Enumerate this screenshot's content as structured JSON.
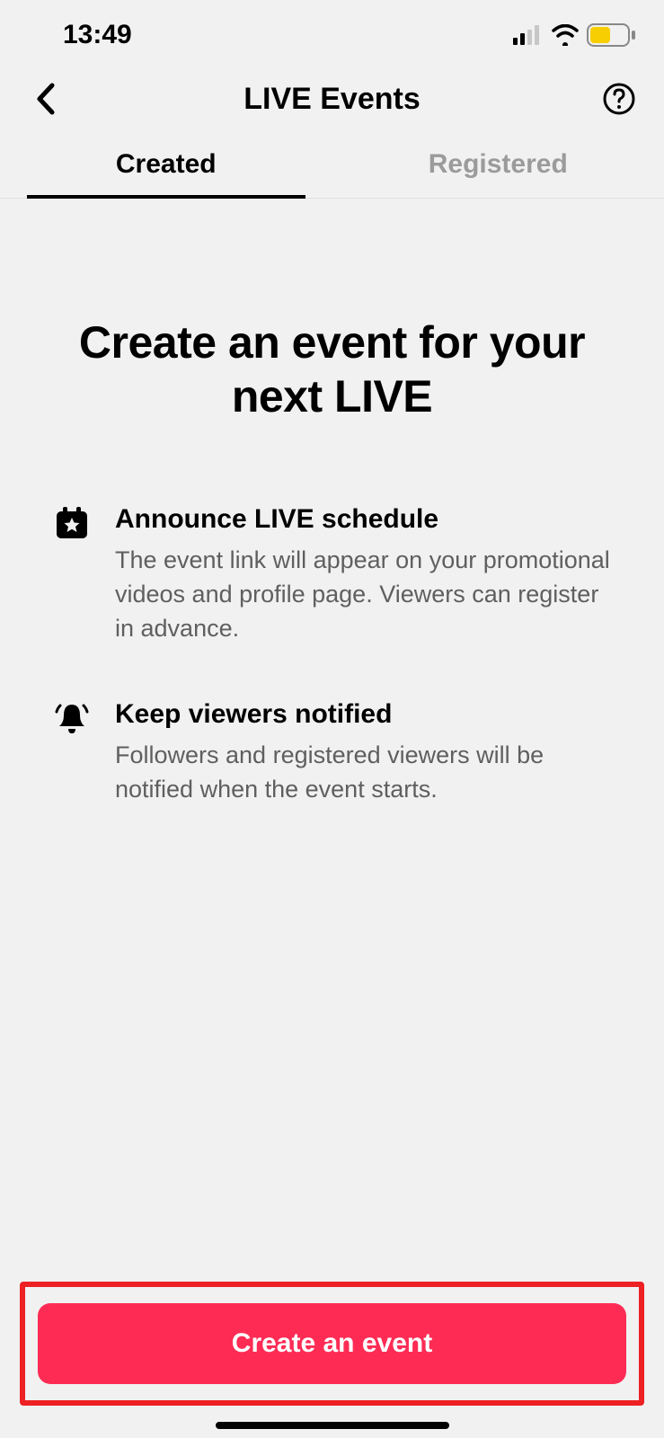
{
  "status": {
    "time": "13:49"
  },
  "header": {
    "title": "LIVE Events"
  },
  "tabs": {
    "created": "Created",
    "registered": "Registered"
  },
  "main": {
    "headline": "Create an event for your next LIVE",
    "features": [
      {
        "title": "Announce LIVE schedule",
        "desc": "The event link will appear on your promotional videos and profile page. Viewers can register in advance."
      },
      {
        "title": "Keep viewers notified",
        "desc": "Followers and registered viewers will be notified when the event starts."
      }
    ]
  },
  "footer": {
    "cta": "Create an event"
  }
}
